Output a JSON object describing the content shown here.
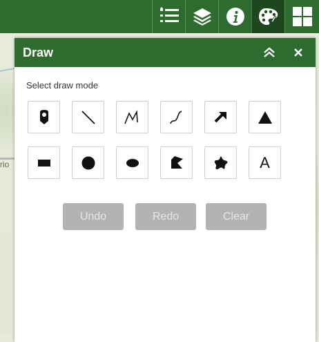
{
  "map": {
    "label_fragment": "rio"
  },
  "toolbar": {
    "items": [
      {
        "name": "legend-list-icon",
        "active": false
      },
      {
        "name": "layers-icon",
        "active": false
      },
      {
        "name": "info-icon",
        "active": false
      },
      {
        "name": "draw-palette-icon",
        "active": true
      },
      {
        "name": "basemap-grid-icon",
        "active": false
      }
    ]
  },
  "panel": {
    "title": "Draw",
    "collapse_icon": "double-chevron-up-icon",
    "close_icon": "close-icon",
    "select_label": "Select draw mode",
    "modes": [
      "point",
      "line",
      "polyline",
      "freehand-polyline",
      "arrow",
      "triangle",
      "rectangle",
      "circle",
      "ellipse",
      "polygon",
      "freehand-polygon",
      "text"
    ],
    "text_mode_glyph": "A",
    "actions": {
      "undo": "Undo",
      "redo": "Redo",
      "clear": "Clear"
    }
  },
  "colors": {
    "header_green": "#2e6b2f",
    "active_tool": "#1d481e",
    "disabled_button": "#b3b3b3"
  }
}
